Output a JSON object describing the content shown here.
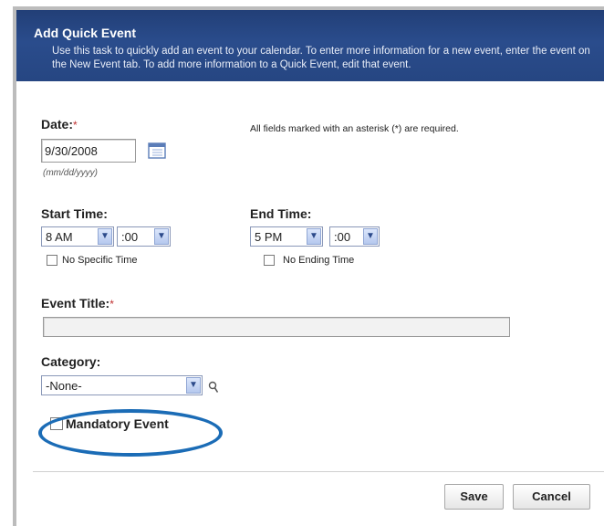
{
  "dialog": {
    "title": "Add Quick Event",
    "description": "Use this task to quickly add an event to your calendar. To enter more information for a new event, enter the event on the New Event tab. To add more information to a Quick Event, edit that event."
  },
  "form": {
    "required_note": "All fields marked with an asterisk (*) are required.",
    "date": {
      "label": "Date:",
      "required_mark": "*",
      "value": "9/30/2008",
      "format_hint": "(mm/dd/yyyy)"
    },
    "start_time": {
      "label": "Start Time:",
      "hour": "8 AM",
      "minute": ":00",
      "no_specific_label": "No Specific Time",
      "no_specific_checked": false
    },
    "end_time": {
      "label": "End Time:",
      "hour": "5 PM",
      "minute": ":00",
      "no_ending_label": "No Ending Time",
      "no_ending_checked": false
    },
    "event_title": {
      "label": "Event Title:",
      "required_mark": "*",
      "value": ""
    },
    "category": {
      "label": "Category:",
      "value": "-None-"
    },
    "mandatory": {
      "label": "Mandatory Event",
      "checked": false
    }
  },
  "buttons": {
    "save": "Save",
    "cancel": "Cancel"
  },
  "colors": {
    "header_bg": "#264682",
    "highlight": "#1b6cb6",
    "required_mark": "#c03030"
  },
  "icons": {
    "calendar": "calendar-icon",
    "lookup": "magnifier-icon",
    "dropdown": "chevron-down-icon"
  }
}
